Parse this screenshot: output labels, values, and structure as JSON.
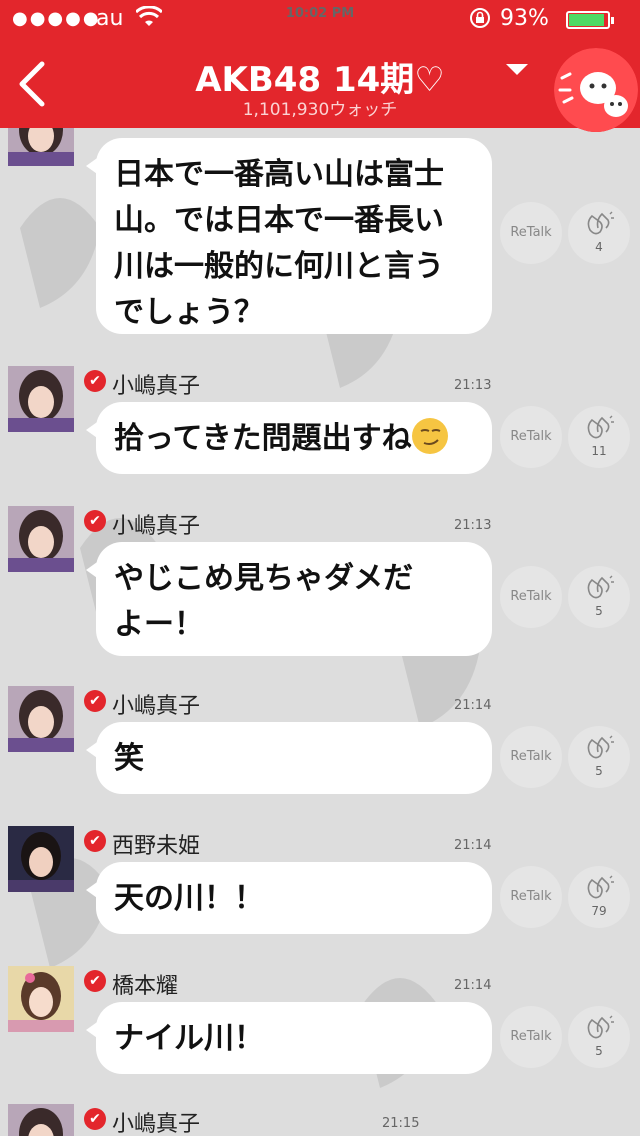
{
  "status_bar": {
    "signal": "●●●●●",
    "carrier": "au",
    "time": "10:02 PM",
    "battery_pct": "93%"
  },
  "nav": {
    "title": "AKB48 14期♡",
    "watch_count": "1,101,930ウォッチ"
  },
  "retalk_label": "ReTalk",
  "messages": [
    {
      "name": "",
      "time": "",
      "lines": [
        "日本で一番高い山は富士",
        "山。では日本で一番長い",
        "川は一般的に何川と言う",
        "でしょう？"
      ],
      "claps": "4"
    },
    {
      "name": "小嶋真子",
      "time": "21:13",
      "lines": [
        "拾ってきた問題出すね"
      ],
      "claps": "11"
    },
    {
      "name": "小嶋真子",
      "time": "21:13",
      "lines": [
        "やじこめ見ちゃダメだ",
        "よー！"
      ],
      "claps": "5"
    },
    {
      "name": "小嶋真子",
      "time": "21:14",
      "lines": [
        "笑"
      ],
      "claps": "5"
    },
    {
      "name": "西野未姫",
      "time": "21:14",
      "lines": [
        "天の川！！"
      ],
      "claps": "79"
    },
    {
      "name": "橋本耀",
      "time": "21:14",
      "lines": [
        "ナイル川！"
      ],
      "claps": "5"
    },
    {
      "name": "小嶋真子",
      "time": "21:15",
      "lines": [],
      "claps": ""
    }
  ]
}
